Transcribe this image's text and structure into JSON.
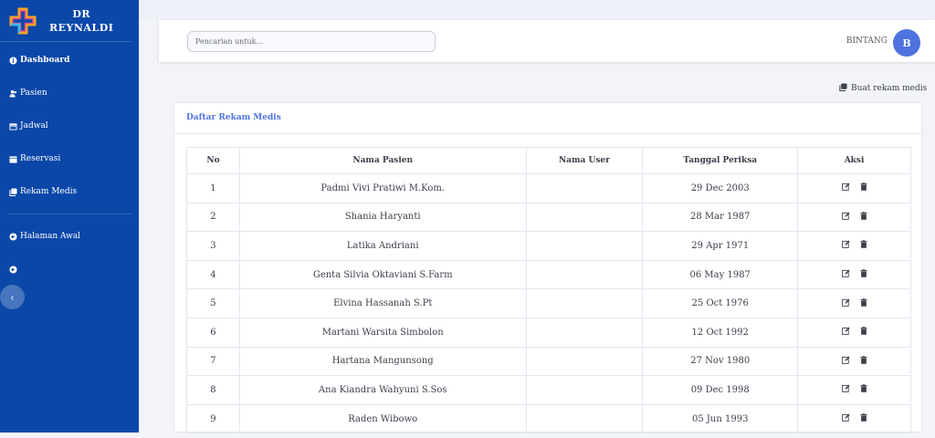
{
  "sidebar": {
    "brand_line1": "DR",
    "brand_line2": "REYNALDI",
    "items": [
      {
        "label": "Dashboard",
        "icon": "info-circle-icon"
      },
      {
        "label": "Pasien",
        "icon": "users-icon"
      },
      {
        "label": "Jadwal",
        "icon": "calendar-icon"
      },
      {
        "label": "Reservasi",
        "icon": "calendar-check-icon"
      },
      {
        "label": "Rekam Medis",
        "icon": "clipboard-icon"
      },
      {
        "label": "Halaman Awal",
        "icon": "arrow-circle-icon"
      }
    ]
  },
  "topbar": {
    "search_placeholder": "Pencarian untuk...",
    "user_name": "BINTANG",
    "avatar_initial": "B"
  },
  "main": {
    "create_label": "Buat rekam medis",
    "card_title": "Daftar Rekam Medis",
    "table": {
      "headers": [
        "No",
        "Nama Pasien",
        "Nama User",
        "Tanggal Periksa",
        "Aksi"
      ],
      "rows": [
        {
          "no": "1",
          "nama": "Padmi Vivi Pratiwi M.Kom.",
          "user": "",
          "tanggal": "29 Dec 2003"
        },
        {
          "no": "2",
          "nama": "Shania Haryanti",
          "user": "",
          "tanggal": "28 Mar 1987"
        },
        {
          "no": "3",
          "nama": "Latika Andriani",
          "user": "",
          "tanggal": "29 Apr 1971"
        },
        {
          "no": "4",
          "nama": "Genta Silvia Oktaviani S.Farm",
          "user": "",
          "tanggal": "06 May 1987"
        },
        {
          "no": "5",
          "nama": "Elvina Hassanah S.Pt",
          "user": "",
          "tanggal": "25 Oct 1976"
        },
        {
          "no": "6",
          "nama": "Martani Warsita Simbolon",
          "user": "",
          "tanggal": "12 Oct 1992"
        },
        {
          "no": "7",
          "nama": "Hartana Mangunsong",
          "user": "",
          "tanggal": "27 Nov 1980"
        },
        {
          "no": "8",
          "nama": "Ana Kiandra Wahyuni S.Sos",
          "user": "",
          "tanggal": "09 Dec 1998"
        },
        {
          "no": "9",
          "nama": "Raden Wibowo",
          "user": "",
          "tanggal": "05 Jun 1993"
        }
      ]
    }
  },
  "colors": {
    "sidebar": "#0a47a8",
    "accent": "#4e73df"
  }
}
